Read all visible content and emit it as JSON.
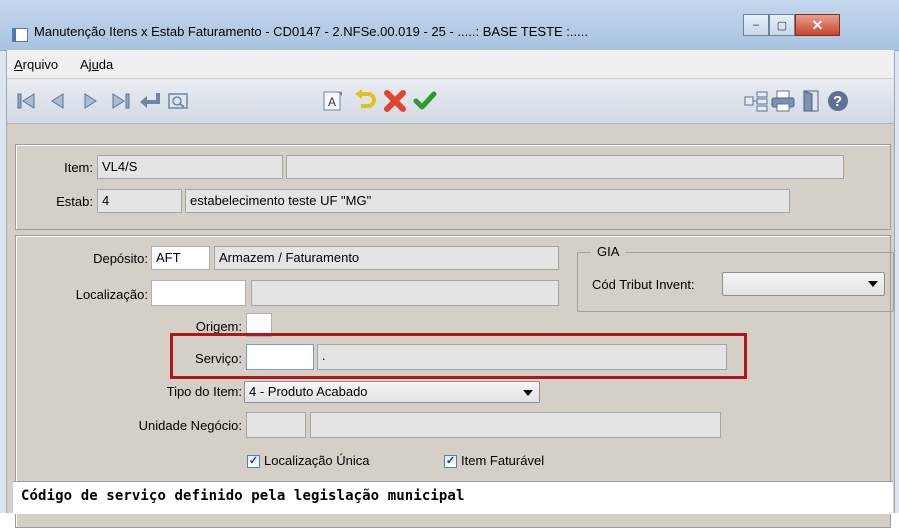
{
  "window": {
    "title": "Manutenção Itens x Estab Faturamento - CD0147 - 2.NFSe.00.019 - 25 - .....: BASE TESTE :.....",
    "minimize": "–",
    "maximize": "▢",
    "close": "✕"
  },
  "menu": {
    "arquivo_hotkey": "A",
    "arquivo_rest": "rquivo",
    "ajuda_pre": "Aj",
    "ajuda_hotkey": "u",
    "ajuda_rest": "da"
  },
  "toolbar": {
    "icons": [
      "first-record-icon",
      "prev-record-icon",
      "next-record-icon",
      "last-record-icon",
      "return-icon",
      "zoom-icon",
      "font-icon",
      "undo-icon",
      "cancel-icon",
      "confirm-icon",
      "query-icon",
      "print-icon",
      "exit-icon",
      "help-icon"
    ],
    "font_glyph": "A",
    "help_glyph": "?"
  },
  "header": {
    "item_label": "Item:",
    "item_value": "VL4/S",
    "item_desc": "",
    "estab_label": "Estab:",
    "estab_value": "4",
    "estab_desc": "estabelecimento teste UF \"MG\""
  },
  "form": {
    "deposito_label": "Depósito:",
    "deposito_value": "AFT",
    "deposito_desc": "Armazem / Faturamento",
    "localizacao_label": "Localização:",
    "localizacao_value": "",
    "localizacao_desc": "",
    "origem_label": "Origem:",
    "origem_value": "",
    "servico_label": "Serviço:",
    "servico_value": "",
    "servico_desc": ".",
    "tipo_item_label": "Tipo do Item:",
    "tipo_item_value": "4 - Produto Acabado",
    "unidade_negocio_label": "Unidade Negócio:",
    "unidade_negocio_value": "",
    "unidade_negocio_desc": "",
    "localizacao_unica_label": "Localização Única",
    "localizacao_unica_checked": true,
    "item_faturavel_label": "Item Faturável",
    "item_faturavel_checked": true,
    "check_glyph": "✓"
  },
  "gia": {
    "title": "GIA",
    "cod_tribut_label": "Cód Tribut Invent:",
    "cod_tribut_value": ""
  },
  "status": {
    "text": "Código de serviço definido pela legislação municipal"
  },
  "colors": {
    "highlight": "#b3151c",
    "cancel_icon": "#e2452e",
    "confirm_icon": "#2e9a2e",
    "undo_icon": "#e0c21a"
  }
}
